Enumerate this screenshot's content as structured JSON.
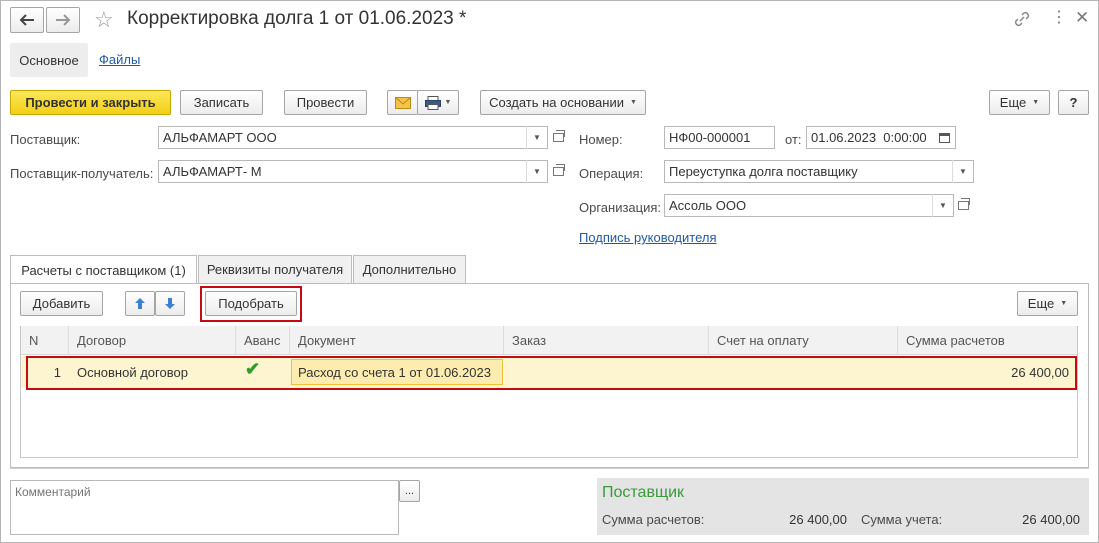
{
  "window": {
    "title": "Корректировка долга 1 от 01.06.2023 *",
    "menu_icon": "more-vertical-icon",
    "link_icon": "link-icon",
    "close_icon": "close-icon"
  },
  "nav": {
    "back_icon": "arrow-left-icon",
    "forward_icon": "arrow-right-icon",
    "star_icon": "star-icon"
  },
  "section_tabs": {
    "main": "Основное",
    "files": "Файлы"
  },
  "toolbar": {
    "post_close": "Провести и закрыть",
    "save": "Записать",
    "post": "Провести",
    "create_based": "Создать на основании",
    "more": "Еще",
    "help": "?"
  },
  "form": {
    "supplier_label": "Поставщик:",
    "supplier_value": "АЛЬФАМАРТ ООО",
    "recipient_label": "Поставщик-получатель:",
    "recipient_value": "АЛЬФАМАРТ- М",
    "number_label": "Номер:",
    "number_value": "НФ00-000001",
    "date_label": "от:",
    "date_value": "01.06.2023  0:00:00",
    "operation_label": "Операция:",
    "operation_value": "Переуступка долга поставщику",
    "org_label": "Организация:",
    "org_value": "Ассоль ООО",
    "signature_link": "Подпись руководителя"
  },
  "tabs": [
    {
      "label": "Расчеты с поставщиком (1)",
      "active": true
    },
    {
      "label": "Реквизиты получателя",
      "active": false
    },
    {
      "label": "Дополнительно",
      "active": false
    }
  ],
  "table_toolbar": {
    "add": "Добавить",
    "select": "Подобрать",
    "more": "Еще"
  },
  "table": {
    "columns": [
      "N",
      "Договор",
      "Аванс",
      "Документ",
      "Заказ",
      "Счет на оплату",
      "Сумма расчетов"
    ],
    "rows": [
      {
        "n": "1",
        "contract": "Основной договор",
        "advance": "✔",
        "document": "Расход со счета 1 от 01.06.2023",
        "order": "",
        "invoice": "",
        "amount": "26 400,00"
      }
    ]
  },
  "comment": {
    "placeholder": "Комментарий",
    "button": "..."
  },
  "summary": {
    "title": "Поставщик",
    "settlement_label": "Сумма расчетов:",
    "settlement_value": "26 400,00",
    "accounting_label": "Сумма учета:",
    "accounting_value": "26 400,00"
  },
  "colors": {
    "accent_yellow": "#f3cf14",
    "highlight_red": "#c40b14",
    "summary_green": "#3a9a3a",
    "row_highlight": "#fdf5d0"
  }
}
